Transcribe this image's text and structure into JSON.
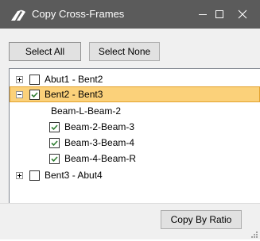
{
  "window": {
    "title": "Copy Cross-Frames",
    "icons": [
      "app-logo-icon",
      "minimize-icon",
      "maximize-icon",
      "close-icon"
    ]
  },
  "toolbar": {
    "select_all_label": "Select All",
    "select_none_label": "Select None"
  },
  "tree": {
    "items": [
      {
        "label": "Abut1 - Bent2",
        "expander": "plus",
        "checked": false,
        "selected": false
      },
      {
        "label": "Bent2 - Bent3",
        "expander": "minus",
        "checked": true,
        "selected": true
      },
      {
        "label": "Beam-L-Beam-2",
        "checkbox": false
      },
      {
        "label": "Beam-2-Beam-3",
        "checked": true
      },
      {
        "label": "Beam-3-Beam-4",
        "checked": true
      },
      {
        "label": "Beam-4-Beam-R",
        "checked": true
      },
      {
        "label": "Bent3 - Abut4",
        "expander": "plus",
        "checked": false,
        "selected": false
      }
    ]
  },
  "footer": {
    "copy_by_ratio_label": "Copy By Ratio"
  },
  "colors": {
    "titlebar": "#5b5b5b",
    "selection_fill": "#fbd17a",
    "selection_border": "#e3a22e",
    "check": "#2f7d32"
  }
}
